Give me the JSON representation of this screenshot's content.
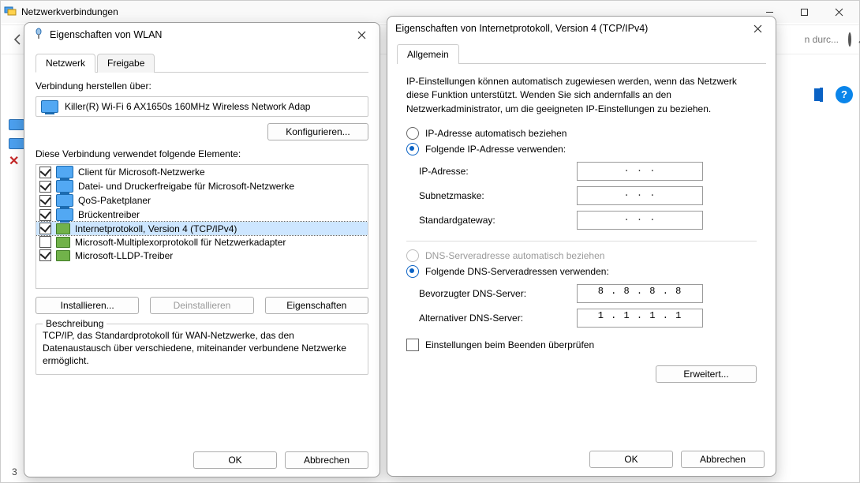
{
  "bg": {
    "title": "Netzwerkverbindungen",
    "search_hint": "n durc...",
    "status": "3"
  },
  "wlan": {
    "title": "Eigenschaften von WLAN",
    "tab_network": "Netzwerk",
    "tab_share": "Freigabe",
    "connect_using_label": "Verbindung herstellen über:",
    "adapter": "Killer(R) Wi-Fi 6 AX1650s 160MHz Wireless Network Adap",
    "configure": "Konfigurieren...",
    "uses_items_label": "Diese Verbindung verwendet folgende Elemente:",
    "items": [
      {
        "label": "Client für Microsoft-Netzwerke",
        "checked": true,
        "iconType": "net"
      },
      {
        "label": "Datei- und Druckerfreigabe für Microsoft-Netzwerke",
        "checked": true,
        "iconType": "net"
      },
      {
        "label": "QoS-Paketplaner",
        "checked": true,
        "iconType": "net"
      },
      {
        "label": "Brückentreiber",
        "checked": true,
        "iconType": "net"
      },
      {
        "label": "Internetprotokoll, Version 4 (TCP/IPv4)",
        "checked": true,
        "iconType": "nic",
        "selected": true
      },
      {
        "label": "Microsoft-Multiplexorprotokoll für Netzwerkadapter",
        "checked": false,
        "iconType": "nic"
      },
      {
        "label": "Microsoft-LLDP-Treiber",
        "checked": true,
        "iconType": "nic"
      }
    ],
    "install": "Installieren...",
    "uninstall": "Deinstallieren",
    "properties": "Eigenschaften",
    "desc_legend": "Beschreibung",
    "desc_text": "TCP/IP, das Standardprotokoll für WAN-Netzwerke, das den Datenaustausch über verschiedene, miteinander verbundene Netzwerke ermöglicht.",
    "ok": "OK",
    "cancel": "Abbrechen"
  },
  "ip": {
    "title": "Eigenschaften von Internetprotokoll, Version 4 (TCP/IPv4)",
    "tab_general": "Allgemein",
    "info": "IP-Einstellungen können automatisch zugewiesen werden, wenn das Netzwerk diese Funktion unterstützt. Wenden Sie sich andernfalls an den Netzwerkadministrator, um die geeigneten IP-Einstellungen zu beziehen.",
    "radio_ip_auto": "IP-Adresse automatisch beziehen",
    "radio_ip_manual": "Folgende IP-Adresse verwenden:",
    "lbl_ip": "IP-Adresse:",
    "lbl_mask": "Subnetzmaske:",
    "lbl_gw": "Standardgateway:",
    "val_ip": " .   .   . ",
    "val_mask": " .   .   . ",
    "val_gw": " .   .   . ",
    "radio_dns_auto": "DNS-Serveradresse automatisch beziehen",
    "radio_dns_manual": "Folgende DNS-Serveradressen verwenden:",
    "lbl_dns1": "Bevorzugter DNS-Server:",
    "lbl_dns2": "Alternativer DNS-Server:",
    "val_dns1": "8  .  8  .  8  .  8",
    "val_dns2": "1  .  1  .  1  .  1",
    "validate_on_exit": "Einstellungen beim Beenden überprüfen",
    "advanced": "Erweitert...",
    "ok": "OK",
    "cancel": "Abbrechen"
  }
}
